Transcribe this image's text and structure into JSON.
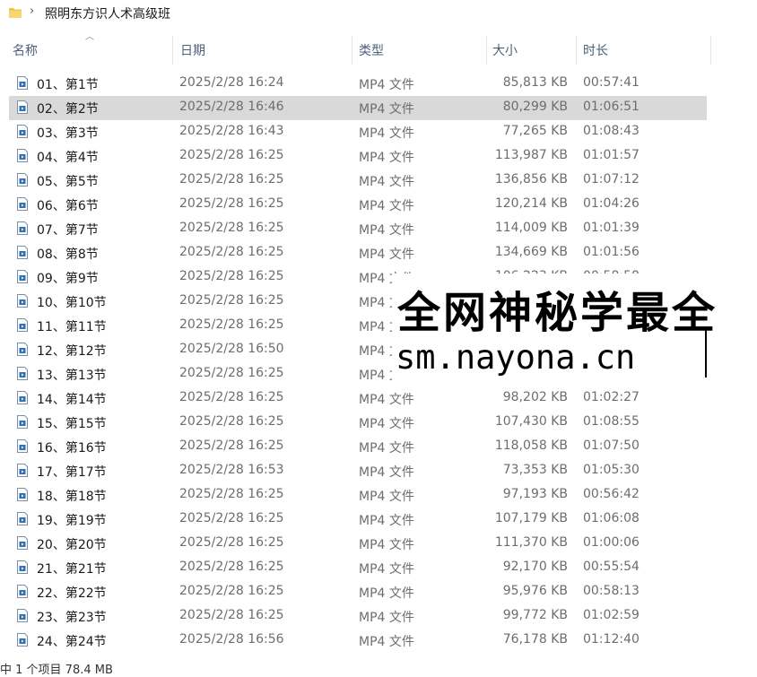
{
  "pathbar": {
    "folder_title": "照明东方识人术高级班"
  },
  "columns": {
    "name": "名称",
    "date": "日期",
    "type": "类型",
    "size": "大小",
    "duration": "时长"
  },
  "files": [
    {
      "name": "01、第1节",
      "date": "2025/2/28 16:24",
      "type": "MP4 文件",
      "size": "85,813 KB",
      "duration": "00:57:41"
    },
    {
      "name": "02、第2节",
      "date": "2025/2/28 16:46",
      "type": "MP4 文件",
      "size": "80,299 KB",
      "duration": "01:06:51",
      "selected": true
    },
    {
      "name": "03、第3节",
      "date": "2025/2/28 16:43",
      "type": "MP4 文件",
      "size": "77,265 KB",
      "duration": "01:08:43"
    },
    {
      "name": "04、第4节",
      "date": "2025/2/28 16:25",
      "type": "MP4 文件",
      "size": "113,987 KB",
      "duration": "01:01:57"
    },
    {
      "name": "05、第5节",
      "date": "2025/2/28 16:25",
      "type": "MP4 文件",
      "size": "136,856 KB",
      "duration": "01:07:12"
    },
    {
      "name": "06、第6节",
      "date": "2025/2/28 16:25",
      "type": "MP4 文件",
      "size": "120,214 KB",
      "duration": "01:04:26"
    },
    {
      "name": "07、第7节",
      "date": "2025/2/28 16:25",
      "type": "MP4 文件",
      "size": "114,009 KB",
      "duration": "01:01:39"
    },
    {
      "name": "08、第8节",
      "date": "2025/2/28 16:25",
      "type": "MP4 文件",
      "size": "134,669 KB",
      "duration": "01:01:56"
    },
    {
      "name": "09、第9节",
      "date": "2025/2/28 16:25",
      "type": "MP4 文件",
      "size": "106,223 KB",
      "duration": "00:58:58"
    },
    {
      "name": "10、第10节",
      "date": "2025/2/28 16:25",
      "type": "MP4 文件",
      "size": "",
      "duration": ""
    },
    {
      "name": "11、第11节",
      "date": "2025/2/28 16:25",
      "type": "MP4 文件",
      "size": "",
      "duration": ""
    },
    {
      "name": "12、第12节",
      "date": "2025/2/28 16:50",
      "type": "MP4 文件",
      "size": "",
      "duration": ""
    },
    {
      "name": "13、第13节",
      "date": "2025/2/28 16:25",
      "type": "MP4 文件",
      "size": "",
      "duration": ""
    },
    {
      "name": "14、第14节",
      "date": "2025/2/28 16:25",
      "type": "MP4 文件",
      "size": "98,202 KB",
      "duration": "01:02:27"
    },
    {
      "name": "15、第15节",
      "date": "2025/2/28 16:25",
      "type": "MP4 文件",
      "size": "107,430 KB",
      "duration": "01:08:55"
    },
    {
      "name": "16、第16节",
      "date": "2025/2/28 16:25",
      "type": "MP4 文件",
      "size": "118,058 KB",
      "duration": "01:07:50"
    },
    {
      "name": "17、第17节",
      "date": "2025/2/28 16:53",
      "type": "MP4 文件",
      "size": "73,353 KB",
      "duration": "01:05:30"
    },
    {
      "name": "18、第18节",
      "date": "2025/2/28 16:25",
      "type": "MP4 文件",
      "size": "97,193 KB",
      "duration": "00:56:42"
    },
    {
      "name": "19、第19节",
      "date": "2025/2/28 16:25",
      "type": "MP4 文件",
      "size": "107,179 KB",
      "duration": "01:06:08"
    },
    {
      "name": "20、第20节",
      "date": "2025/2/28 16:25",
      "type": "MP4 文件",
      "size": "111,370 KB",
      "duration": "01:00:06"
    },
    {
      "name": "21、第21节",
      "date": "2025/2/28 16:25",
      "type": "MP4 文件",
      "size": "92,170 KB",
      "duration": "00:55:54"
    },
    {
      "name": "22、第22节",
      "date": "2025/2/28 16:25",
      "type": "MP4 文件",
      "size": "95,976 KB",
      "duration": "00:58:13"
    },
    {
      "name": "23、第23节",
      "date": "2025/2/28 16:25",
      "type": "MP4 文件",
      "size": "99,772 KB",
      "duration": "01:02:59"
    },
    {
      "name": "24、第24节",
      "date": "2025/2/28 16:56",
      "type": "MP4 文件",
      "size": "76,178 KB",
      "duration": "01:12:40"
    }
  ],
  "status": {
    "text": "中 1 个项目 78.4 MB"
  },
  "watermark": {
    "line1": "全网神秘学最全",
    "line2": "sm.nayona.cn"
  },
  "icons": {
    "folder": "folder-icon",
    "chevron": "chevron-right-icon",
    "file": "video-file-icon",
    "sort": "sort-ascending-icon"
  },
  "colors": {
    "selected_row": "#d9d9d9",
    "header_text": "#4c607a",
    "folder": "#f4c542",
    "file_icon": "#2f6fb5"
  }
}
